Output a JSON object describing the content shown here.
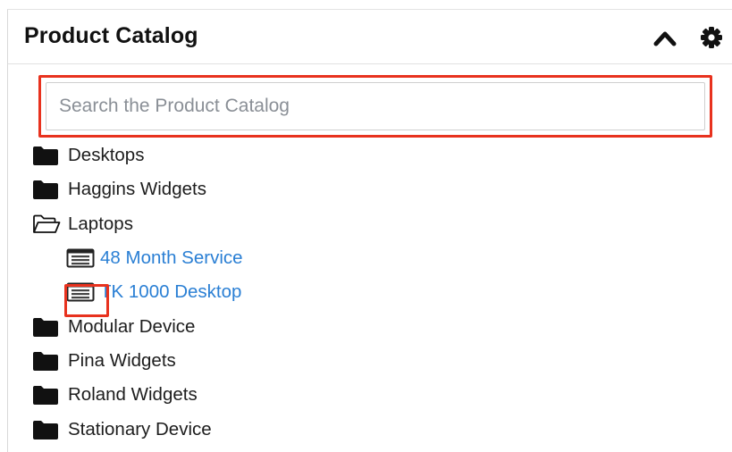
{
  "header": {
    "title": "Product Catalog",
    "collapse_icon": "chevron-up-icon",
    "settings_icon": "gear-icon"
  },
  "search": {
    "placeholder": "Search the Product Catalog",
    "value": ""
  },
  "tree": [
    {
      "label": "Desktops",
      "type": "folder",
      "state": "closed",
      "depth": 0
    },
    {
      "label": "Haggins Widgets",
      "type": "folder",
      "state": "closed",
      "depth": 0
    },
    {
      "label": "Laptops",
      "type": "folder",
      "state": "open",
      "depth": 0
    },
    {
      "label": "48 Month Service",
      "type": "product",
      "depth": 1
    },
    {
      "label": "TK 1000 Desktop",
      "type": "product",
      "depth": 1
    },
    {
      "label": "Modular Device",
      "type": "folder",
      "state": "closed",
      "depth": 0
    },
    {
      "label": "Pina Widgets",
      "type": "folder",
      "state": "closed",
      "depth": 0
    },
    {
      "label": "Roland Widgets",
      "type": "folder",
      "state": "closed",
      "depth": 0
    },
    {
      "label": "Stationary Device",
      "type": "folder",
      "state": "closed",
      "depth": 0
    }
  ],
  "colors": {
    "highlight": "#e8321e",
    "link": "#2a7fd4"
  }
}
